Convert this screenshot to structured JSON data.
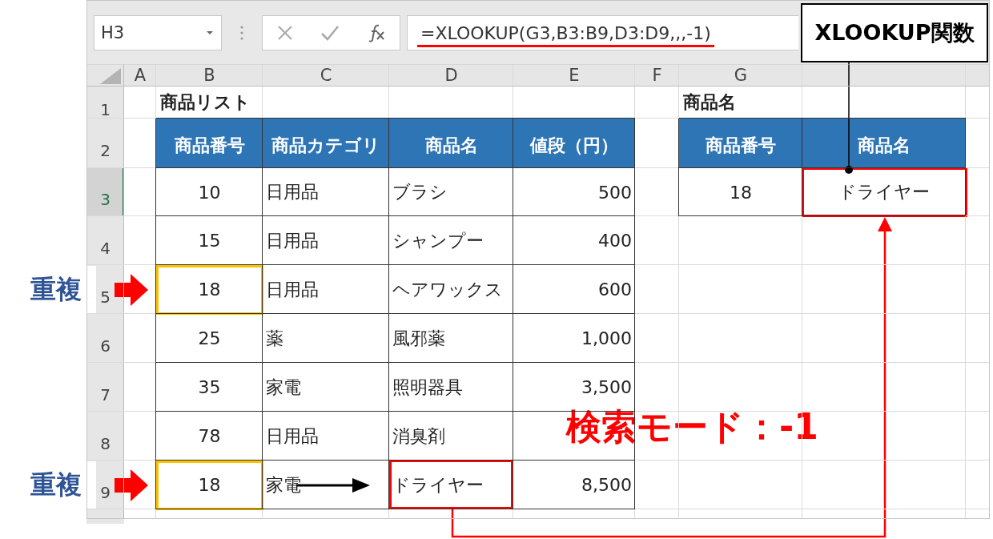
{
  "formula_bar": {
    "name_box": "H3",
    "formula": "=XLOOKUP(G3,B3:B9,D3:D9,,,-1)"
  },
  "column_headers": [
    "A",
    "B",
    "C",
    "D",
    "E",
    "F",
    "G"
  ],
  "row_headers": [
    {
      "label": "1",
      "selected": false
    },
    {
      "label": "2",
      "selected": false
    },
    {
      "label": "3",
      "selected": true
    },
    {
      "label": "4",
      "selected": false
    },
    {
      "label": "5",
      "selected": false
    },
    {
      "label": "6",
      "selected": false
    },
    {
      "label": "7",
      "selected": false
    },
    {
      "label": "8",
      "selected": false
    },
    {
      "label": "9",
      "selected": false
    }
  ],
  "product_list": {
    "title": "商品リスト",
    "columns": [
      "商品番号",
      "商品カテゴリ",
      "商品名",
      "値段（円）"
    ],
    "rows": [
      {
        "cells": [
          "10",
          "日用品",
          "ブラシ",
          "500"
        ],
        "duplicate": false,
        "matched": false
      },
      {
        "cells": [
          "15",
          "日用品",
          "シャンプー",
          "400"
        ],
        "duplicate": false,
        "matched": false
      },
      {
        "cells": [
          "18",
          "日用品",
          "ヘアワックス",
          "600"
        ],
        "duplicate": true,
        "duplicate_label": "重複",
        "matched": false
      },
      {
        "cells": [
          "25",
          "薬",
          "風邪薬",
          "1,000"
        ],
        "duplicate": false,
        "matched": false
      },
      {
        "cells": [
          "35",
          "家電",
          "照明器具",
          "3,500"
        ],
        "duplicate": false,
        "matched": false
      },
      {
        "cells": [
          "78",
          "日用品",
          "消臭剤",
          null
        ],
        "duplicate": false,
        "matched": false
      },
      {
        "cells": [
          "18",
          "家電",
          "ドライヤー",
          "8,500"
        ],
        "duplicate": true,
        "duplicate_label": "重複",
        "matched": true
      }
    ]
  },
  "lookup": {
    "title": "商品名",
    "columns": [
      "商品番号",
      "商品名"
    ],
    "cells": [
      "18",
      "ドライヤー"
    ],
    "highlighted": true
  },
  "annotations": {
    "function_callout": "XLOOKUP関数",
    "mode_label": "検索モード：-1"
  }
}
